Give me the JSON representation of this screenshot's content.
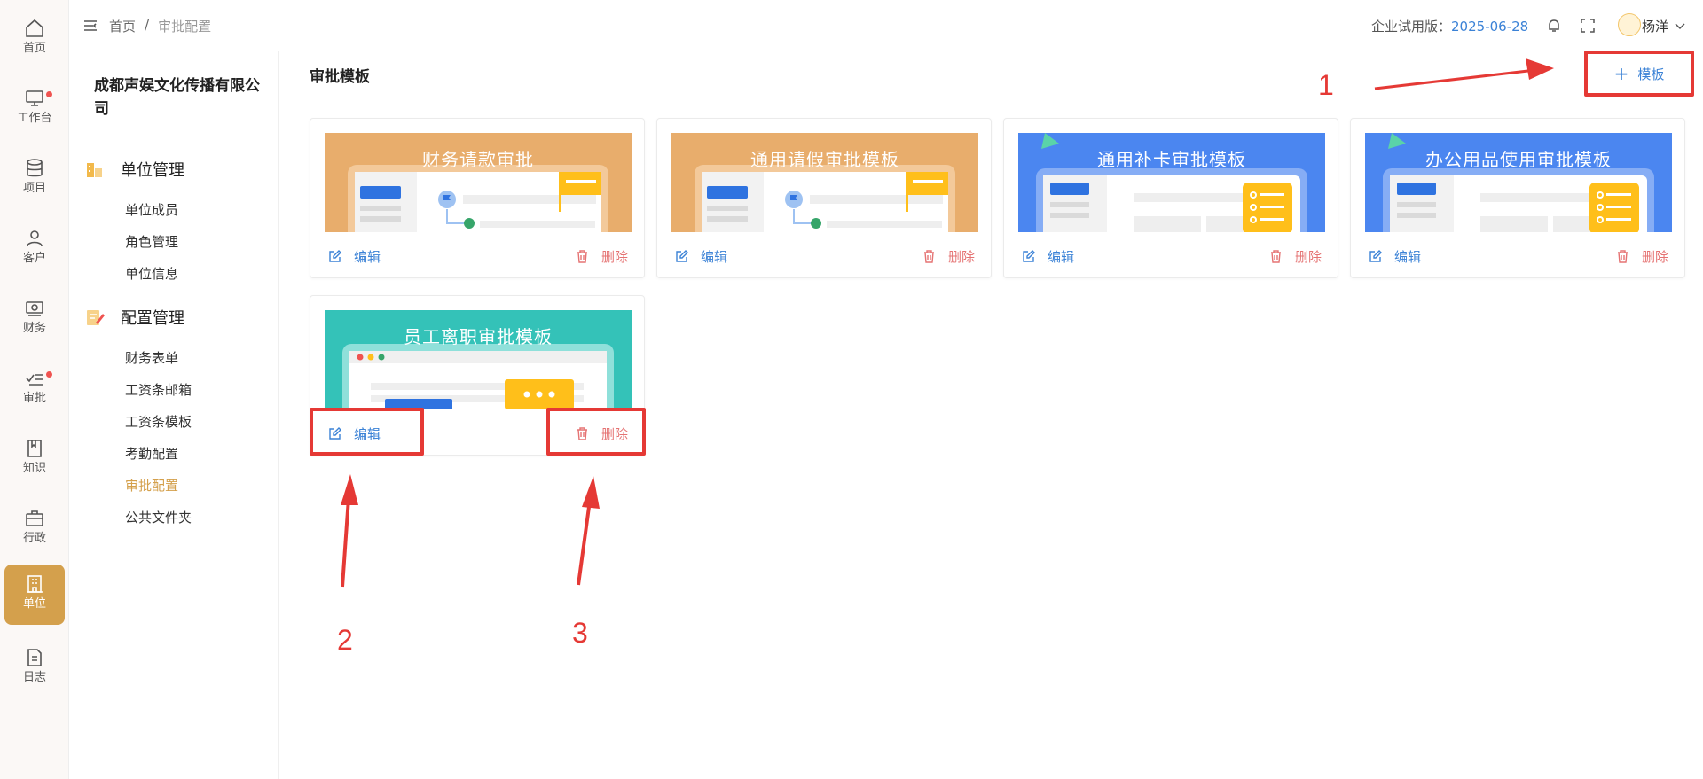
{
  "rail": {
    "items": [
      {
        "label": "首页",
        "icon": "home-icon"
      },
      {
        "label": "工作台",
        "icon": "monitor-icon",
        "badge": true
      },
      {
        "label": "项目",
        "icon": "database-icon"
      },
      {
        "label": "客户",
        "icon": "user-icon"
      },
      {
        "label": "财务",
        "icon": "finance-icon"
      },
      {
        "label": "审批",
        "icon": "approval-icon",
        "badge": true
      },
      {
        "label": "知识",
        "icon": "book-icon"
      },
      {
        "label": "行政",
        "icon": "briefcase-icon"
      },
      {
        "label": "单位",
        "icon": "building-icon",
        "active": true
      },
      {
        "label": "日志",
        "icon": "document-icon"
      }
    ]
  },
  "sidebar": {
    "company": "成都声娱文化传播有限公司",
    "groups": [
      {
        "title": "单位管理",
        "items": [
          "单位成员",
          "角色管理",
          "单位信息"
        ]
      },
      {
        "title": "配置管理",
        "items": [
          "财务表单",
          "工资条邮箱",
          "工资条模板",
          "考勤配置",
          "审批配置",
          "公共文件夹"
        ]
      }
    ],
    "active_item": "审批配置"
  },
  "topbar": {
    "breadcrumb_home": "首页",
    "breadcrumb_sep": "/",
    "breadcrumb_current": "审批配置",
    "trial_label": "企业试用版：",
    "trial_date": "2025-06-28",
    "username": "杨洋"
  },
  "main": {
    "title": "审批模板",
    "add_label": "模板",
    "edit_label": "编辑",
    "delete_label": "删除",
    "templates": [
      {
        "name": "财务请款审批",
        "theme": "orange"
      },
      {
        "name": "通用请假审批模板",
        "theme": "orange"
      },
      {
        "name": "通用补卡审批模板",
        "theme": "blue"
      },
      {
        "name": "办公用品使用审批模板",
        "theme": "blue"
      },
      {
        "name": "员工离职审批模板",
        "theme": "teal"
      }
    ]
  },
  "annotations": {
    "n1": "1",
    "n2": "2",
    "n3": "3"
  },
  "colors": {
    "accent": "#d4a04c",
    "link": "#3b82d6",
    "danger": "#e57373",
    "annotation": "#e53935"
  }
}
